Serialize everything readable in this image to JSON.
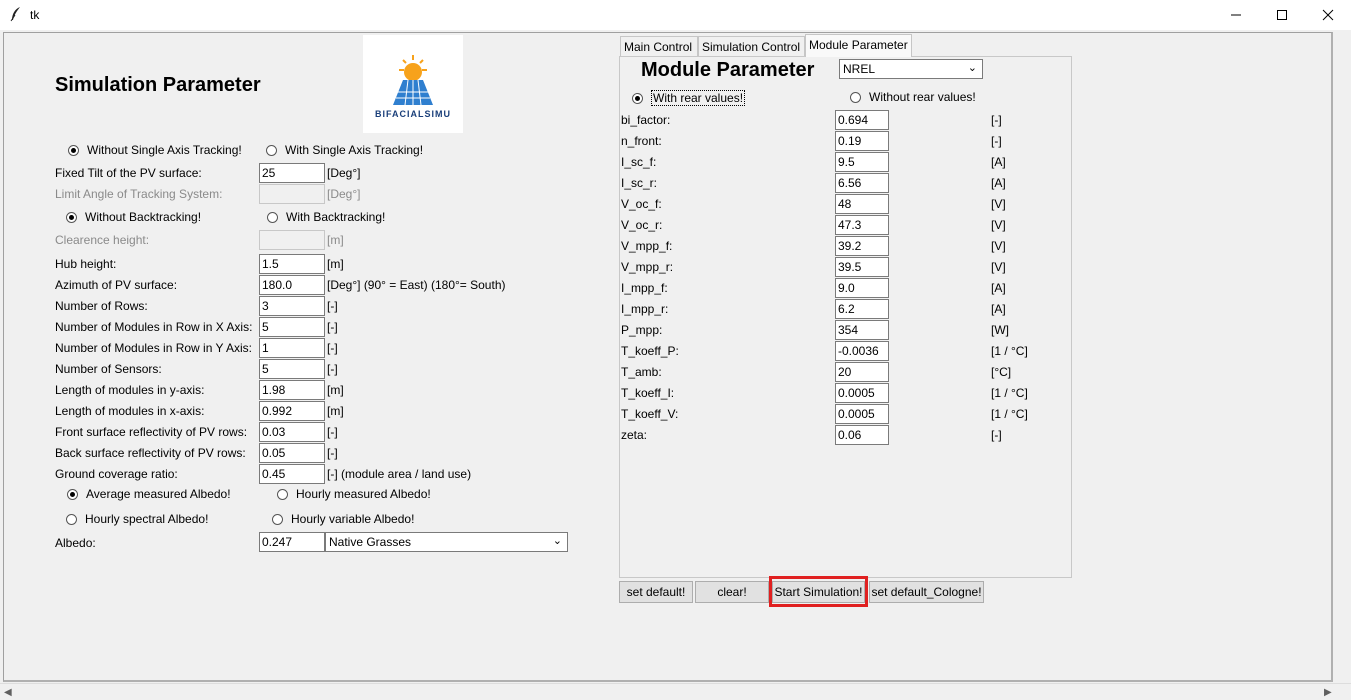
{
  "window": {
    "title": "tk"
  },
  "logo": {
    "text": "BIFACIALSIMU",
    "colors": {
      "sun": "#f7a21b",
      "panel": "#2f7fcf"
    }
  },
  "left": {
    "heading": "Simulation Parameter",
    "tracking": {
      "without": "Without Single Axis Tracking!",
      "with": "With Single Axis Tracking!",
      "selected": "without"
    },
    "fixed_tilt": {
      "label": "Fixed Tilt of the PV surface:",
      "value": "25",
      "unit": "[Deg°]"
    },
    "limit_angle": {
      "label": "Limit Angle of Tracking System:",
      "value": "",
      "unit": "[Deg°]"
    },
    "backtracking": {
      "without": "Without Backtracking!",
      "with": "With Backtracking!",
      "selected": "without"
    },
    "clearance": {
      "label": "Clearence height:",
      "value": "",
      "unit": "[m]"
    },
    "rows": [
      {
        "label": "Hub height:",
        "value": "1.5",
        "unit": "[m]"
      },
      {
        "label": "Azimuth of PV surface:",
        "value": "180.0",
        "unit": "[Deg°] (90° = East) (180°= South)"
      },
      {
        "label": "Number of Rows:",
        "value": "3",
        "unit": "[-]"
      },
      {
        "label": "Number of Modules in Row in X Axis:",
        "value": "5",
        "unit": "[-]"
      },
      {
        "label": "Number of Modules in Row in Y Axis:",
        "value": "1",
        "unit": "[-]"
      },
      {
        "label": "Number of Sensors:",
        "value": "5",
        "unit": "[-]"
      },
      {
        "label": "Length of modules in y-axis:",
        "value": "1.98",
        "unit": "[m]"
      },
      {
        "label": "Length of modules in x-axis:",
        "value": "0.992",
        "unit": "[m]"
      },
      {
        "label": "Front surface reflectivity of PV rows:",
        "value": "0.03",
        "unit": "[-]"
      },
      {
        "label": "Back surface reflectivity of PV rows:",
        "value": "0.05",
        "unit": "[-]"
      },
      {
        "label": "Ground coverage ratio:",
        "value": "0.45",
        "unit": "[-] (module area / land use)"
      }
    ],
    "albedo_mode": {
      "average": "Average measured Albedo!",
      "hourly": "Hourly measured Albedo!",
      "spectral": "Hourly spectral Albedo!",
      "variable": "Hourly variable Albedo!",
      "selected": "average"
    },
    "albedo": {
      "label": "Albedo:",
      "value": "0.247",
      "surface": "Native Grasses"
    }
  },
  "tabs": [
    {
      "label": "Main Control",
      "active": false
    },
    {
      "label": "Simulation Control",
      "active": false
    },
    {
      "label": "Module Parameter",
      "active": true
    }
  ],
  "module": {
    "heading": "Module Parameter",
    "preset": "NREL",
    "rear": {
      "with": "With rear values!",
      "without": "Without rear values!",
      "selected": "with"
    },
    "params": [
      {
        "label": "bi_factor:",
        "value": "0.694",
        "unit": "[-]"
      },
      {
        "label": "n_front:",
        "value": "0.19",
        "unit": "[-]"
      },
      {
        "label": "I_sc_f:",
        "value": "9.5",
        "unit": "[A]"
      },
      {
        "label": "I_sc_r:",
        "value": "6.56",
        "unit": "[A]"
      },
      {
        "label": "V_oc_f:",
        "value": "48",
        "unit": "[V]"
      },
      {
        "label": "V_oc_r:",
        "value": "47.3",
        "unit": "[V]"
      },
      {
        "label": "V_mpp_f:",
        "value": "39.2",
        "unit": "[V]"
      },
      {
        "label": "V_mpp_r:",
        "value": "39.5",
        "unit": "[V]"
      },
      {
        "label": "I_mpp_f:",
        "value": "9.0",
        "unit": "[A]"
      },
      {
        "label": "I_mpp_r:",
        "value": "6.2",
        "unit": "[A]"
      },
      {
        "label": "P_mpp:",
        "value": "354",
        "unit": "[W]"
      },
      {
        "label": "T_koeff_P:",
        "value": "-0.0036",
        "unit": "[1 / °C]"
      },
      {
        "label": "T_amb:",
        "value": "20",
        "unit": "[°C]"
      },
      {
        "label": "T_koeff_I:",
        "value": "0.0005",
        "unit": "[1 / °C]"
      },
      {
        "label": "T_koeff_V:",
        "value": "0.0005",
        "unit": "[1 / °C]"
      },
      {
        "label": "zeta:",
        "value": "0.06",
        "unit": "[-]"
      }
    ]
  },
  "buttons": {
    "set_default": "set default!",
    "clear": "clear!",
    "start": "Start Simulation!",
    "set_default_cologne": "set default_Cologne!"
  },
  "colors": {
    "highlight": "#e02020"
  }
}
